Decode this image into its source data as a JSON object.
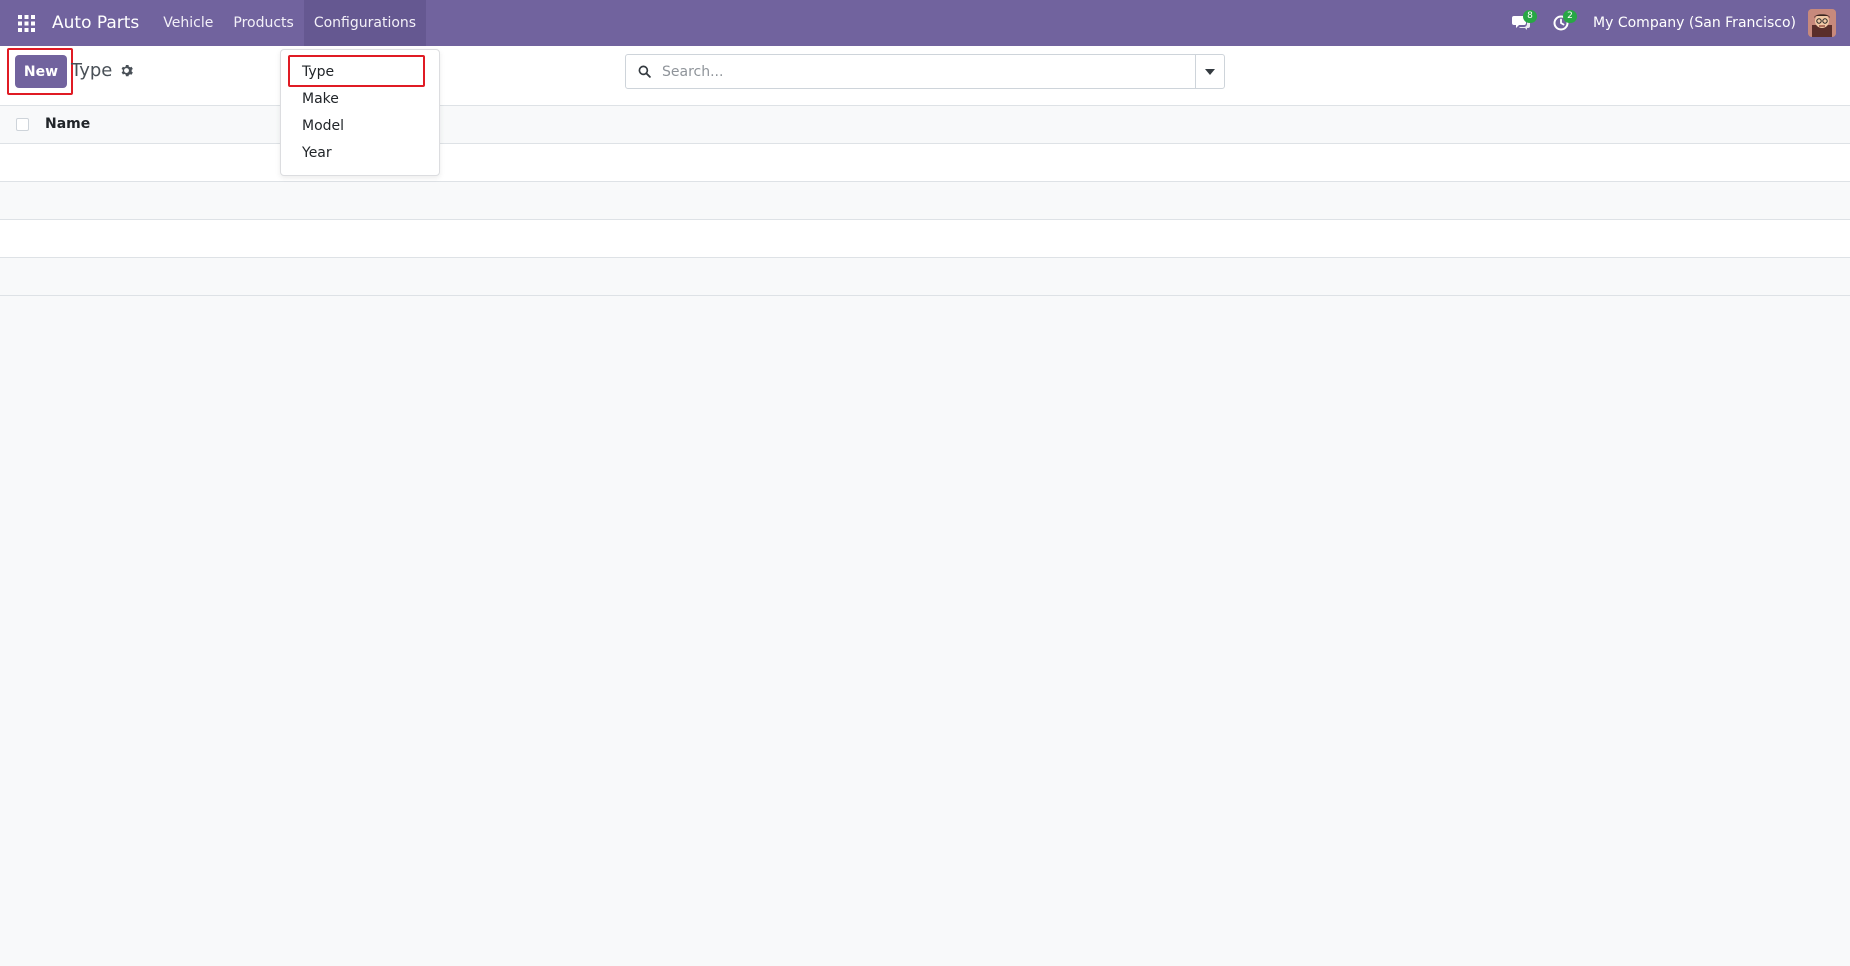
{
  "navbar": {
    "app_name": "Auto Parts",
    "menu": [
      {
        "label": "Vehicle"
      },
      {
        "label": "Products"
      },
      {
        "label": "Configurations"
      }
    ],
    "messages_count": "8",
    "activities_count": "2",
    "company": "My Company (San Francisco)",
    "icons": {
      "apps": "grid-icon",
      "messages": "chat-icon",
      "activities": "clock-icon",
      "avatar": "user-avatar"
    },
    "colors": {
      "brand": "#71639e",
      "badge": "#28a745",
      "highlight": "#e01b24"
    }
  },
  "control_panel": {
    "new_label": "New",
    "breadcrumb": "Type",
    "settings_icon": "gear-icon",
    "search_placeholder": "Search..."
  },
  "list": {
    "columns": [
      {
        "label": "Name"
      }
    ],
    "rows": []
  },
  "dropdown": {
    "items": [
      {
        "label": "Type"
      },
      {
        "label": "Make"
      },
      {
        "label": "Model"
      },
      {
        "label": "Year"
      }
    ]
  }
}
